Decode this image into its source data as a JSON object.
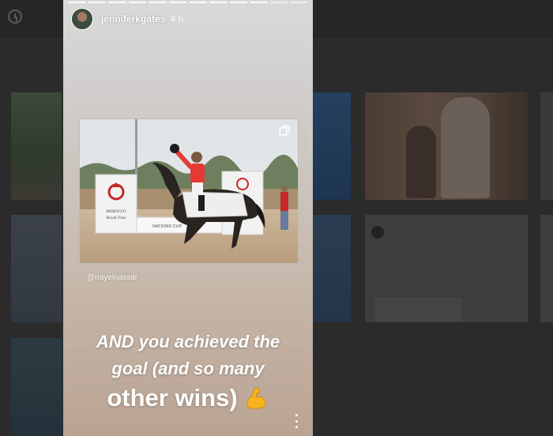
{
  "story": {
    "username": "jenniferkgates",
    "age": "4 h",
    "photo_credit": "@nayelnassar",
    "caption_line1": "AND you achieved the",
    "caption_line2": "goal (and so many",
    "caption_line3": "other wins)",
    "progress_segments": 12,
    "photo_sign_left": [
      "Royal Tour"
    ],
    "photo_sign_center": "NATIONS CUP",
    "icons": {
      "more": "more-options-icon",
      "multi": "carousel-icon",
      "emoji": "flexed-biceps-emoji"
    }
  },
  "colors": {
    "story_top": "#d9d9d9",
    "story_bottom": "#bba392",
    "overlay_bg": "#2b2b2b",
    "text": "#ffffff"
  }
}
